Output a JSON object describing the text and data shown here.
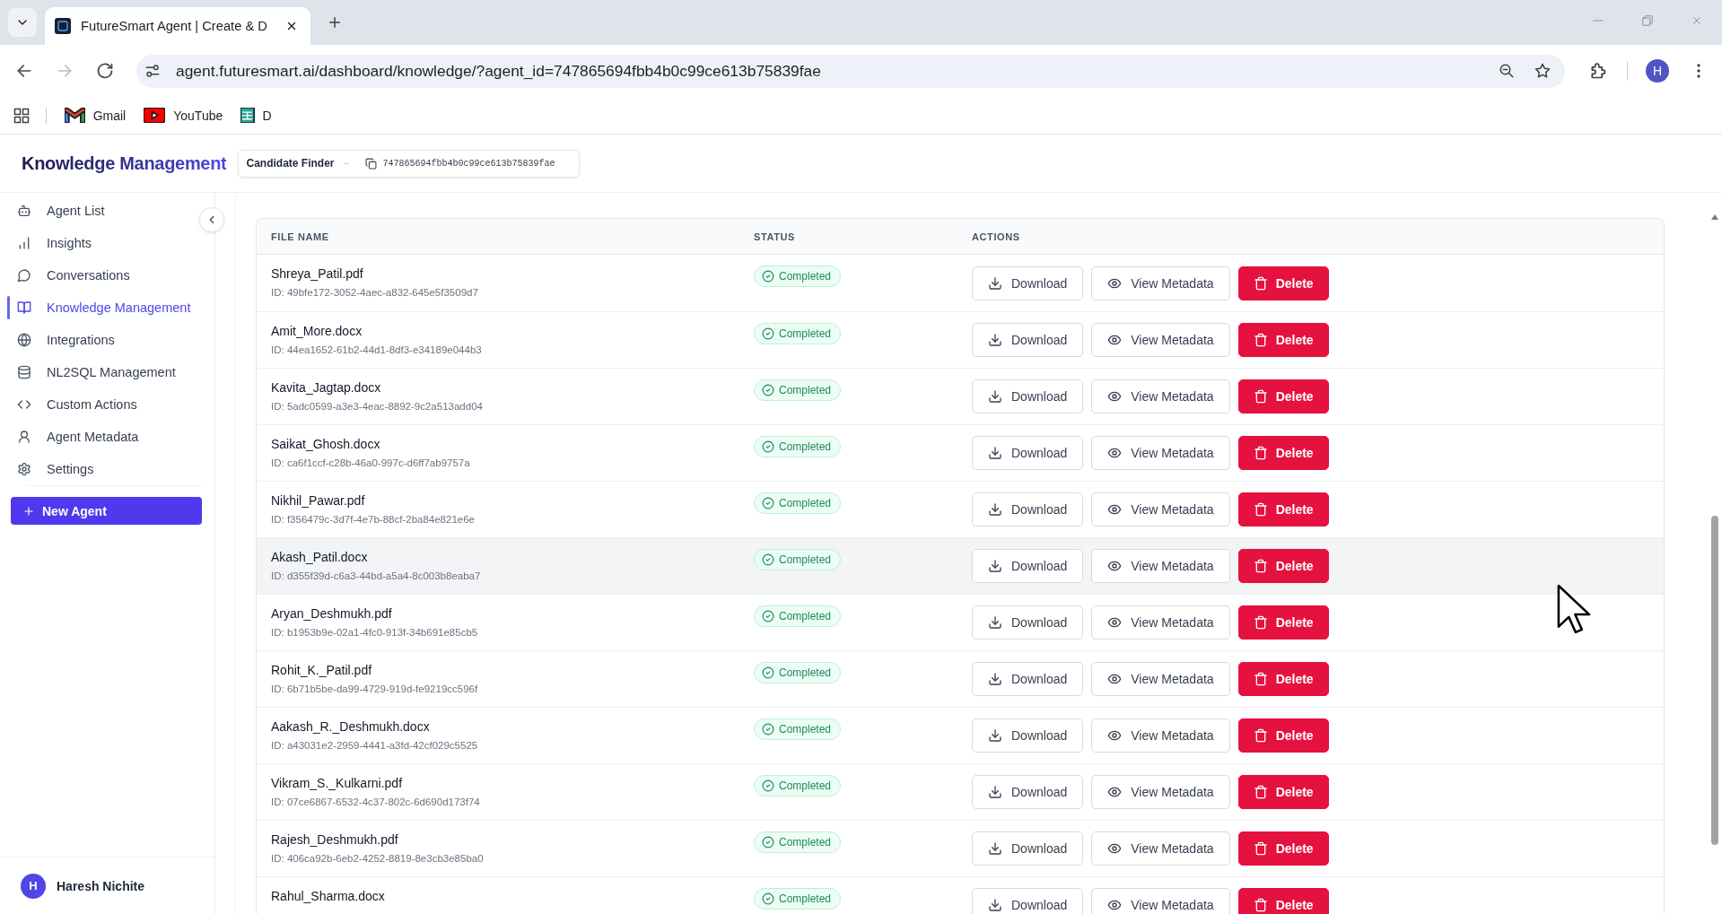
{
  "browser": {
    "tab_title": "FutureSmart Agent | Create & D",
    "nav": [
      {
        "disabled": false
      },
      {
        "disabled": true
      },
      {
        "disabled": false
      }
    ],
    "address": "agent.futuresmart.ai/dashboard/knowledge/?agent_id=747865694fbb4b0c99ce613b75839fae",
    "profile_initial": "H",
    "bookmarks": [
      {
        "label": "Gmail"
      },
      {
        "label": "YouTube"
      },
      {
        "label": "D"
      }
    ]
  },
  "header": {
    "title": "Knowledge Management",
    "agent_name": "Candidate Finder",
    "agent_id": "747865694fbb4b0c99ce613b75839fae"
  },
  "sidebar": {
    "items": [
      {
        "label": "Agent List",
        "selected": false
      },
      {
        "label": "Insights",
        "selected": false
      },
      {
        "label": "Conversations",
        "selected": false
      },
      {
        "label": "Knowledge Management",
        "selected": true
      },
      {
        "label": "Integrations",
        "selected": false
      },
      {
        "label": "NL2SQL Management",
        "selected": false
      },
      {
        "label": "Custom Actions",
        "selected": false
      },
      {
        "label": "Agent Metadata",
        "selected": false
      },
      {
        "label": "Settings",
        "selected": false
      }
    ],
    "new_agent_button": "New Agent",
    "user": {
      "initial": "H",
      "name": "Haresh Nichite"
    }
  },
  "table": {
    "columns": [
      "FILE NAME",
      "STATUS",
      "ACTIONS"
    ],
    "rows": [
      {
        "file_name": "Shreya_Patil.pdf",
        "file_id": "ID: 49bfe172-3052-4aec-a832-645e5f3509d7",
        "status": "Completed",
        "highlighted": false,
        "actions": [
          {
            "kind": "download",
            "label": "Download"
          },
          {
            "kind": "view",
            "label": "View Metadata"
          },
          {
            "kind": "delete",
            "label": "Delete"
          }
        ]
      },
      {
        "file_name": "Amit_More.docx",
        "file_id": "ID: 44ea1652-61b2-44d1-8df3-e34189e044b3",
        "status": "Completed",
        "highlighted": false,
        "actions": [
          {
            "kind": "download",
            "label": "Download"
          },
          {
            "kind": "view",
            "label": "View Metadata"
          },
          {
            "kind": "delete",
            "label": "Delete"
          }
        ]
      },
      {
        "file_name": "Kavita_Jagtap.docx",
        "file_id": "ID: 5adc0599-a3e3-4eac-8892-9c2a513add04",
        "status": "Completed",
        "highlighted": false,
        "actions": [
          {
            "kind": "download",
            "label": "Download"
          },
          {
            "kind": "view",
            "label": "View Metadata"
          },
          {
            "kind": "delete",
            "label": "Delete"
          }
        ]
      },
      {
        "file_name": "Saikat_Ghosh.docx",
        "file_id": "ID: ca6f1ccf-c28b-46a0-997c-d6ff7ab9757a",
        "status": "Completed",
        "highlighted": false,
        "actions": [
          {
            "kind": "download",
            "label": "Download"
          },
          {
            "kind": "view",
            "label": "View Metadata"
          },
          {
            "kind": "delete",
            "label": "Delete"
          }
        ]
      },
      {
        "file_name": "Nikhil_Pawar.pdf",
        "file_id": "ID: f356479c-3d7f-4e7b-88cf-2ba84e821e6e",
        "status": "Completed",
        "highlighted": false,
        "actions": [
          {
            "kind": "download",
            "label": "Download"
          },
          {
            "kind": "view",
            "label": "View Metadata"
          },
          {
            "kind": "delete",
            "label": "Delete"
          }
        ]
      },
      {
        "file_name": "Akash_Patil.docx",
        "file_id": "ID: d355f39d-c6a3-44bd-a5a4-8c003b8eaba7",
        "status": "Completed",
        "highlighted": true,
        "actions": [
          {
            "kind": "download",
            "label": "Download"
          },
          {
            "kind": "view",
            "label": "View Metadata"
          },
          {
            "kind": "delete",
            "label": "Delete"
          }
        ]
      },
      {
        "file_name": "Aryan_Deshmukh.pdf",
        "file_id": "ID: b1953b9e-02a1-4fc0-913f-34b691e85cb5",
        "status": "Completed",
        "highlighted": false,
        "actions": [
          {
            "kind": "download",
            "label": "Download"
          },
          {
            "kind": "view",
            "label": "View Metadata"
          },
          {
            "kind": "delete",
            "label": "Delete"
          }
        ]
      },
      {
        "file_name": "Rohit_K._Patil.pdf",
        "file_id": "ID: 6b71b5be-da99-4729-919d-fe9219cc596f",
        "status": "Completed",
        "highlighted": false,
        "actions": [
          {
            "kind": "download",
            "label": "Download"
          },
          {
            "kind": "view",
            "label": "View Metadata"
          },
          {
            "kind": "delete",
            "label": "Delete"
          }
        ]
      },
      {
        "file_name": "Aakash_R._Deshmukh.docx",
        "file_id": "ID: a43031e2-2959-4441-a3fd-42cf029c5525",
        "status": "Completed",
        "highlighted": false,
        "actions": [
          {
            "kind": "download",
            "label": "Download"
          },
          {
            "kind": "view",
            "label": "View Metadata"
          },
          {
            "kind": "delete",
            "label": "Delete"
          }
        ]
      },
      {
        "file_name": "Vikram_S._Kulkarni.pdf",
        "file_id": "ID: 07ce6867-6532-4c37-802c-6d690d173f74",
        "status": "Completed",
        "highlighted": false,
        "actions": [
          {
            "kind": "download",
            "label": "Download"
          },
          {
            "kind": "view",
            "label": "View Metadata"
          },
          {
            "kind": "delete",
            "label": "Delete"
          }
        ]
      },
      {
        "file_name": "Rajesh_Deshmukh.pdf",
        "file_id": "ID: 406ca92b-6eb2-4252-8819-8e3cb3e85ba0",
        "status": "Completed",
        "highlighted": false,
        "actions": [
          {
            "kind": "download",
            "label": "Download"
          },
          {
            "kind": "view",
            "label": "View Metadata"
          },
          {
            "kind": "delete",
            "label": "Delete"
          }
        ]
      },
      {
        "file_name": "Rahul_Sharma.docx",
        "status": "Completed",
        "highlighted": false,
        "actions": [
          {
            "kind": "download",
            "label": "Download"
          },
          {
            "kind": "view",
            "label": "View Metadata"
          },
          {
            "kind": "delete",
            "label": "Delete"
          }
        ]
      }
    ]
  }
}
